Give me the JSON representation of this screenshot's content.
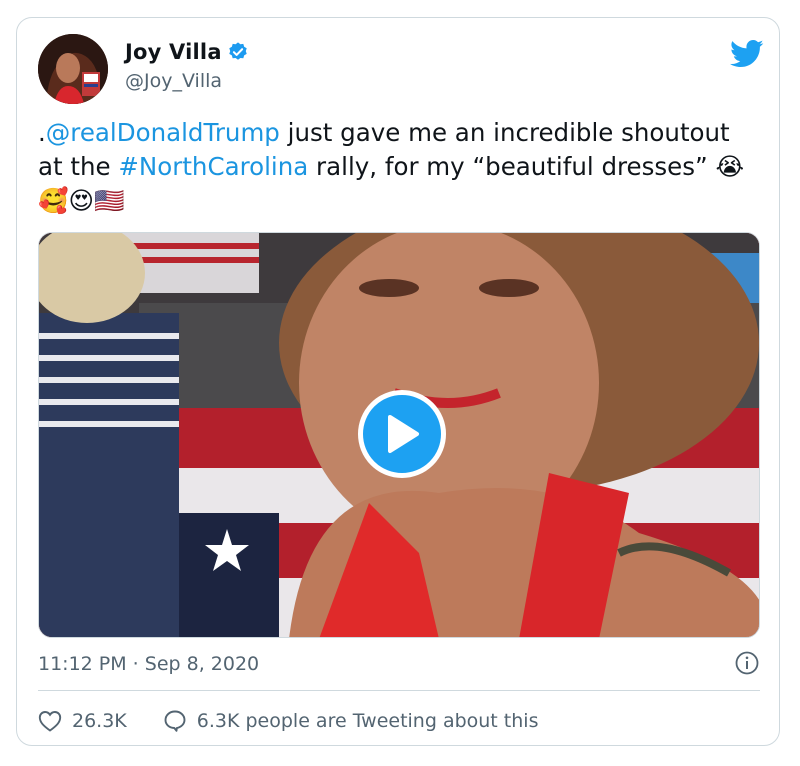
{
  "author": {
    "display_name": "Joy Villa",
    "handle": "@Joy_Villa",
    "verified": true
  },
  "tweet": {
    "text_prefix": ".",
    "mention": "@realDonaldTrump",
    "text_mid": " just gave me an incredible shoutout at the ",
    "hashtag": "#NorthCarolina",
    "text_end": " rally, for my “beautiful dresses” ",
    "emojis": "😭🥰😍🇺🇸"
  },
  "media": {
    "type": "video",
    "play_icon": "play-icon"
  },
  "meta": {
    "timestamp": "11:12 PM · Sep 8, 2020"
  },
  "engagement": {
    "likes": "26.3K",
    "conversation": "6.3K people are Tweeting about this"
  },
  "colors": {
    "link": "#1b95e0",
    "brand": "#1da1f2",
    "muted": "#536471",
    "border": "#cfd9de"
  }
}
